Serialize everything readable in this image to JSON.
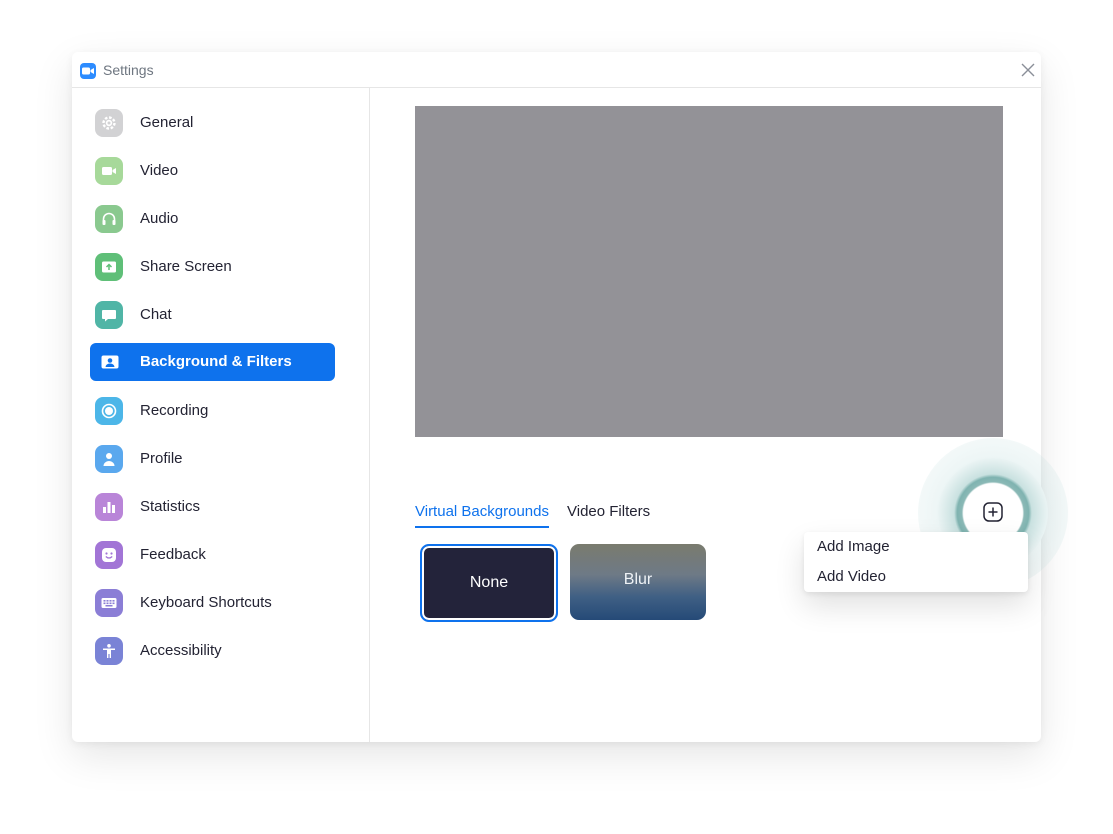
{
  "window": {
    "title": "Settings"
  },
  "sidebar": {
    "items": [
      {
        "label": "General",
        "icon": "gear-icon",
        "color": "#d2d2d4"
      },
      {
        "label": "Video",
        "icon": "video-camera-icon",
        "color": "#a7d99a"
      },
      {
        "label": "Audio",
        "icon": "headphones-icon",
        "color": "#8ac98f"
      },
      {
        "label": "Share Screen",
        "icon": "share-screen-icon",
        "color": "#5fbf78"
      },
      {
        "label": "Chat",
        "icon": "chat-bubble-icon",
        "color": "#50b5a6"
      },
      {
        "label": "Background & Filters",
        "icon": "background-person-icon",
        "color": "#0e72ed",
        "active": true
      },
      {
        "label": "Recording",
        "icon": "record-icon",
        "color": "#4cb6e8"
      },
      {
        "label": "Profile",
        "icon": "profile-icon",
        "color": "#5aa8ee"
      },
      {
        "label": "Statistics",
        "icon": "bar-chart-icon",
        "color": "#b985d8"
      },
      {
        "label": "Feedback",
        "icon": "smiley-icon",
        "color": "#a275d6"
      },
      {
        "label": "Keyboard Shortcuts",
        "icon": "keyboard-icon",
        "color": "#8b7ed6"
      },
      {
        "label": "Accessibility",
        "icon": "accessibility-icon",
        "color": "#7a83d6"
      }
    ]
  },
  "main": {
    "tabs": [
      {
        "label": "Virtual Backgrounds",
        "active": true
      },
      {
        "label": "Video Filters",
        "active": false
      }
    ],
    "backgrounds": [
      {
        "label": "None",
        "selected": true
      },
      {
        "label": "Blur",
        "selected": false
      }
    ],
    "add_menu": {
      "items": [
        "Add Image",
        "Add Video"
      ]
    }
  },
  "colors": {
    "accent": "#0e72ed",
    "preview": "#939297"
  }
}
